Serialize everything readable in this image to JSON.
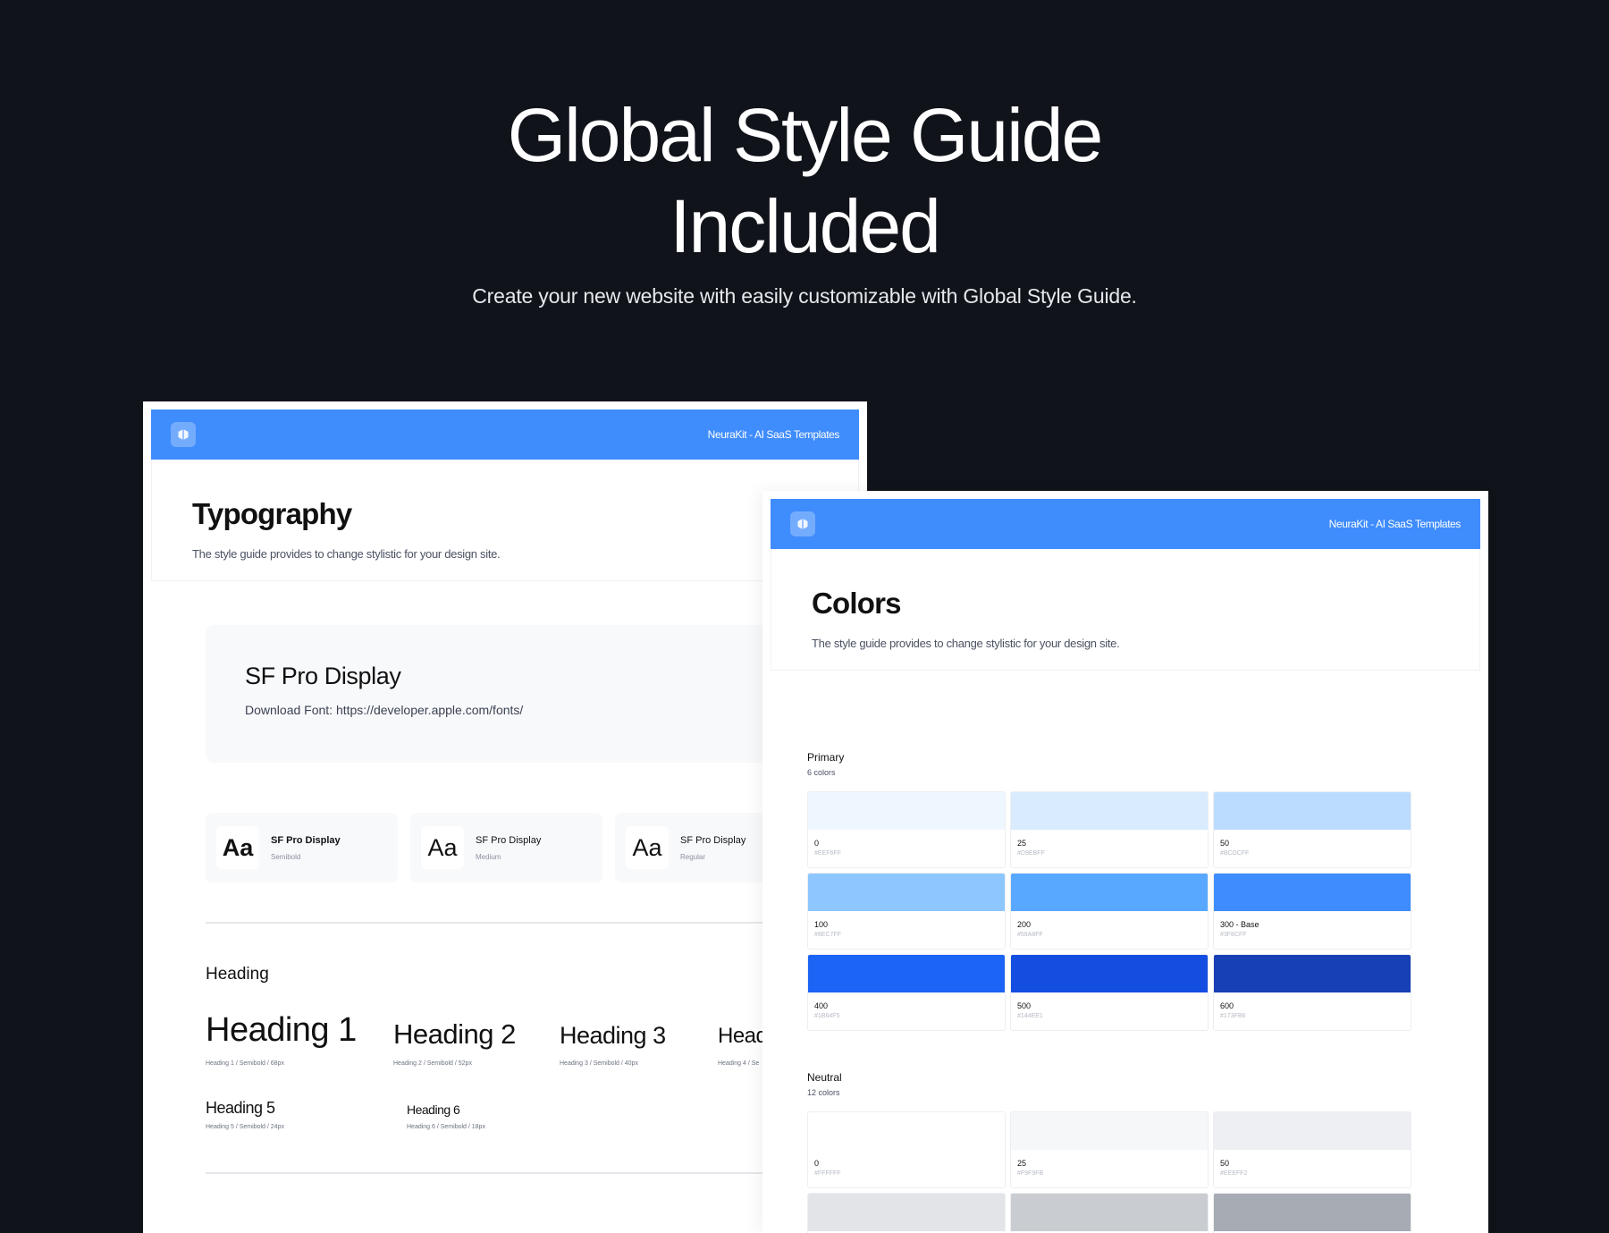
{
  "hero": {
    "title_line1": "Global Style Guide",
    "title_line2": "Included",
    "subtitle": "Create your new website with easily customizable with Global Style Guide."
  },
  "brand": "NeuraKit - AI SaaS Templates",
  "colors_theme": {
    "topbar": "#3f8cfd",
    "background": "#10131a"
  },
  "typography_page": {
    "title": "Typography",
    "description": "The style guide provides to change stylistic for your design site.",
    "font_name": "SF Pro Display",
    "font_link": "Download Font: https://developer.apple.com/fonts/",
    "weights": [
      {
        "sample": "Aa",
        "name": "SF Pro Display",
        "weight": "Semibold"
      },
      {
        "sample": "Aa",
        "name": "SF Pro Display",
        "weight": "Medium"
      },
      {
        "sample": "Aa",
        "name": "SF Pro Display",
        "weight": "Regular"
      }
    ],
    "heading_section": "Heading",
    "headings": [
      {
        "label": "Heading 1",
        "spec": "Heading 1 / Semibold / 68px"
      },
      {
        "label": "Heading 2",
        "spec": "Heading 2 / Semibold / 52px"
      },
      {
        "label": "Heading 3",
        "spec": "Heading 3 / Semibold / 40px"
      },
      {
        "label": "Head",
        "spec": "Heading 4 / Se"
      },
      {
        "label": "Heading 5",
        "spec": "Heading 5 / Semibold / 24px"
      },
      {
        "label": "Heading 6",
        "spec": "Heading 6 / Semibold / 18px"
      }
    ]
  },
  "colors_page": {
    "title": "Colors",
    "description": "The style guide provides to change stylistic for your design site.",
    "primary": {
      "label": "Primary",
      "count": "6 colors",
      "swatches": [
        {
          "name": "0",
          "hex": "#EEF6FF",
          "color": "#EEF6FF"
        },
        {
          "name": "25",
          "hex": "#D9EBFF",
          "color": "#D9EBFF"
        },
        {
          "name": "50",
          "hex": "#BCDCFF",
          "color": "#BCDCFF"
        },
        {
          "name": "100",
          "hex": "#8EC7FF",
          "color": "#8EC7FF"
        },
        {
          "name": "200",
          "hex": "#59A8FF",
          "color": "#59A8FF"
        },
        {
          "name": "300 - Base",
          "hex": "#3F8CFF",
          "color": "#3F8CFF"
        },
        {
          "name": "400",
          "hex": "#1B64F5",
          "color": "#1B64F5"
        },
        {
          "name": "500",
          "hex": "#144EE1",
          "color": "#144EE1"
        },
        {
          "name": "600",
          "hex": "#173FB6",
          "color": "#173FB6"
        }
      ]
    },
    "neutral": {
      "label": "Neutral",
      "count": "12 colors",
      "swatches": [
        {
          "name": "0",
          "hex": "#FFFFFF",
          "color": "#FFFFFF"
        },
        {
          "name": "25",
          "hex": "#F9F9FB",
          "color": "#F6F7F8"
        },
        {
          "name": "50",
          "hex": "#EEEFF2",
          "color": "#EEEFF2"
        }
      ],
      "next_row_colors": [
        "#E3E4E7",
        "#C9CCD1",
        "#A6ABB4"
      ]
    }
  }
}
